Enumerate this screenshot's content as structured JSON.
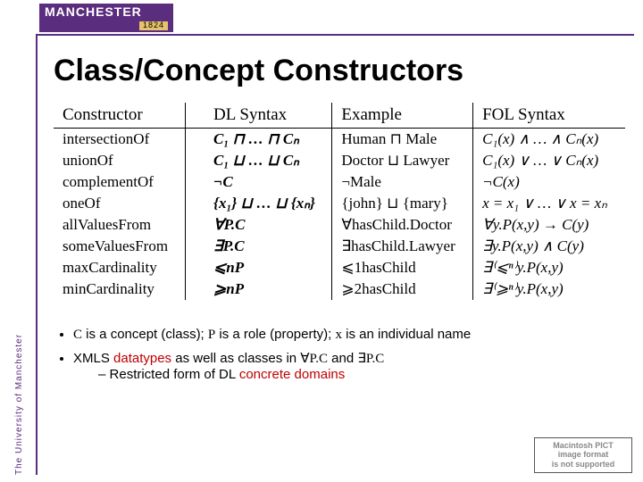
{
  "branding": {
    "logo_main": "MANCHESTER",
    "logo_year": "1824",
    "sidebar": "The University of Manchester"
  },
  "title": "Class/Concept Constructors",
  "table": {
    "headers": [
      "Constructor",
      "DL Syntax",
      "Example",
      "FOL Syntax"
    ],
    "rows": [
      {
        "c": "intersectionOf",
        "dl": "C₁ ⊓ … ⊓ Cₙ",
        "ex": "Human ⊓ Male",
        "fol": "C₁(x) ∧ … ∧ Cₙ(x)"
      },
      {
        "c": "unionOf",
        "dl": "C₁ ⊔ … ⊔ Cₙ",
        "ex": "Doctor ⊔ Lawyer",
        "fol": "C₁(x) ∨ … ∨ Cₙ(x)"
      },
      {
        "c": "complementOf",
        "dl": "¬C",
        "ex": "¬Male",
        "fol": "¬C(x)"
      },
      {
        "c": "oneOf",
        "dl": "{x₁} ⊔ … ⊔ {xₙ}",
        "ex": "{john} ⊔ {mary}",
        "fol": "x = x₁ ∨ … ∨ x = xₙ"
      },
      {
        "c": "allValuesFrom",
        "dl": "∀P.C",
        "ex": "∀hasChild.Doctor",
        "fol": "∀y.P(x,y) → C(y)"
      },
      {
        "c": "someValuesFrom",
        "dl": "∃P.C",
        "ex": "∃hasChild.Lawyer",
        "fol": "∃y.P(x,y) ∧ C(y)"
      },
      {
        "c": "maxCardinality",
        "dl": "⩽nP",
        "ex": "⩽1hasChild",
        "fol": "∃⁽⩽ⁿ⁾y.P(x,y)"
      },
      {
        "c": "minCardinality",
        "dl": "⩾nP",
        "ex": "⩾2hasChild",
        "fol": "∃⁽⩾ⁿ⁾y.P(x,y)"
      }
    ]
  },
  "bullets": {
    "b1_pre": "",
    "b1_c": "C",
    "b1_mid1": " is a concept (class); ",
    "b1_p": "P",
    "b1_mid2": " is a role (property); ",
    "b1_x": "x",
    "b1_end": " is an individual name",
    "b2_pre": "XMLS ",
    "b2_red": "datatypes",
    "b2_mid": " as well as classes in ",
    "b2_all": "∀P.C",
    "b2_and": " and ",
    "b2_ex": "∃P.C",
    "sub1": "Restricted form of DL ",
    "sub1_red": "concrete domains"
  },
  "pict": {
    "l1": "Macintosh PICT",
    "l2": "image format",
    "l3": "is not supported"
  }
}
